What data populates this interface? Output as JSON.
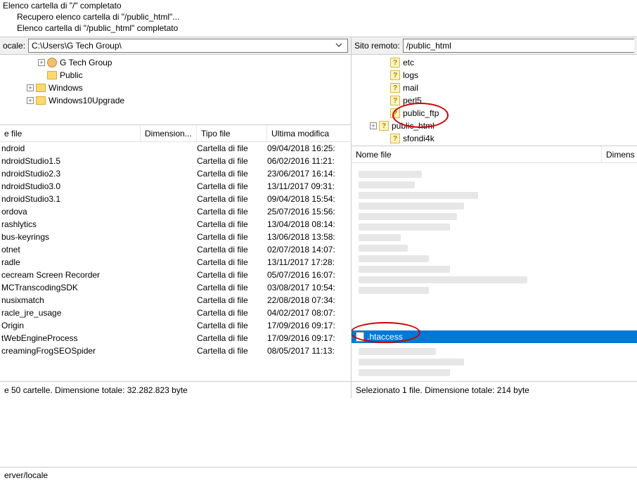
{
  "log": {
    "l1": "Elenco cartella di \"/\" completato",
    "l2": "Recupero elenco cartella di \"/public_html\"...",
    "l3": "Elenco cartella di \"/public_html\" completato"
  },
  "local": {
    "label": "ocale:",
    "path": "C:\\Users\\G Tech Group\\",
    "tree": [
      {
        "indent": 52,
        "expander": "+",
        "icon": "user",
        "name": "G Tech Group"
      },
      {
        "indent": 52,
        "expander": "",
        "icon": "folder",
        "name": "Public"
      },
      {
        "indent": 36,
        "expander": "+",
        "icon": "folder",
        "name": "Windows"
      },
      {
        "indent": 36,
        "expander": "+",
        "icon": "folder",
        "name": "Windows10Upgrade"
      }
    ],
    "headers": {
      "name": "e file",
      "size": "Dimension...",
      "type": "Tipo file",
      "mod": "Ultima modifica"
    },
    "files": [
      {
        "name": "ndroid",
        "type": "Cartella di file",
        "mod": "09/04/2018 16:25:"
      },
      {
        "name": "ndroidStudio1.5",
        "type": "Cartella di file",
        "mod": "06/02/2016 11:21:"
      },
      {
        "name": "ndroidStudio2.3",
        "type": "Cartella di file",
        "mod": "23/06/2017 16:14:"
      },
      {
        "name": "ndroidStudio3.0",
        "type": "Cartella di file",
        "mod": "13/11/2017 09:31:"
      },
      {
        "name": "ndroidStudio3.1",
        "type": "Cartella di file",
        "mod": "09/04/2018 15:54:"
      },
      {
        "name": "ordova",
        "type": "Cartella di file",
        "mod": "25/07/2016 15:56:"
      },
      {
        "name": "rashlytics",
        "type": "Cartella di file",
        "mod": "13/04/2018 08:14:"
      },
      {
        "name": "bus-keyrings",
        "type": "Cartella di file",
        "mod": "13/06/2018 13:58:"
      },
      {
        "name": "otnet",
        "type": "Cartella di file",
        "mod": "02/07/2018 14:07:"
      },
      {
        "name": "radle",
        "type": "Cartella di file",
        "mod": "13/11/2017 17:28:"
      },
      {
        "name": "cecream Screen Recorder",
        "type": "Cartella di file",
        "mod": "05/07/2016 16:07:"
      },
      {
        "name": "MCTranscodingSDK",
        "type": "Cartella di file",
        "mod": "03/08/2017 10:54:"
      },
      {
        "name": "nusixmatch",
        "type": "Cartella di file",
        "mod": "22/08/2018 07:34:"
      },
      {
        "name": "racle_jre_usage",
        "type": "Cartella di file",
        "mod": "04/02/2017 08:07:"
      },
      {
        "name": "Origin",
        "type": "Cartella di file",
        "mod": "17/09/2016 09:17:"
      },
      {
        "name": "tWebEngineProcess",
        "type": "Cartella di file",
        "mod": "17/09/2016 09:17:"
      },
      {
        "name": "creamingFrogSEOSpider",
        "type": "Cartella di file",
        "mod": "08/05/2017 11:13:"
      }
    ],
    "status": "e 50 cartelle. Dimensione totale: 32.282.823 byte"
  },
  "remote": {
    "label": "Sito remoto:",
    "path": "/public_html",
    "tree": [
      {
        "indent": 40,
        "expander": "",
        "icon": "q",
        "name": "etc"
      },
      {
        "indent": 40,
        "expander": "",
        "icon": "q",
        "name": "logs"
      },
      {
        "indent": 40,
        "expander": "",
        "icon": "q",
        "name": "mail"
      },
      {
        "indent": 40,
        "expander": "",
        "icon": "q",
        "name": "perl5"
      },
      {
        "indent": 40,
        "expander": "",
        "icon": "q",
        "name": "public_ftp"
      },
      {
        "indent": 24,
        "expander": "+",
        "icon": "q",
        "name": "public_html"
      },
      {
        "indent": 40,
        "expander": "",
        "icon": "q",
        "name": "sfondi4k"
      }
    ],
    "headers": {
      "name": "Nome file",
      "size": "Dimens"
    },
    "selected_file": ".htaccess",
    "status": "Selezionato 1 file. Dimensione totale: 214 byte"
  },
  "footer": "erver/locale"
}
